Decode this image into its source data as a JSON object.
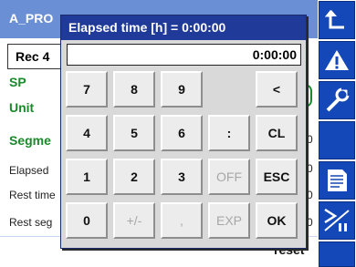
{
  "background": {
    "title": "A_PRO",
    "rec_label": "Rec 4",
    "labels": [
      "SP",
      "Unit",
      "Segme"
    ],
    "small_labels": [
      "Elapsed",
      "Rest time",
      "Rest seg"
    ],
    "field_digits": [
      "0",
      "0",
      "0",
      "0"
    ],
    "reset_label": "reset"
  },
  "sidebar": {
    "buttons": [
      "arrow-up-icon",
      "warning-icon",
      "wrench-icon",
      "blank",
      "document-icon",
      "start-pause-icon"
    ]
  },
  "dialog": {
    "title": "Elapsed time [h] = 0:00:00",
    "display_value": "0:00:00",
    "keys": [
      [
        "7",
        "8",
        "9",
        "",
        "<"
      ],
      [
        "4",
        "5",
        "6",
        ":",
        "CL"
      ],
      [
        "1",
        "2",
        "3",
        "OFF",
        "ESC"
      ],
      [
        "0",
        "+/-",
        ",",
        "EXP",
        "OK"
      ]
    ],
    "disabled_keys": [
      "+/-",
      ",",
      "OFF",
      "EXP"
    ]
  },
  "colors": {
    "title_bar": "#1f3a98",
    "sidebar_button": "#1447b8",
    "label_green": "#1a8a2a",
    "background_header": "#6b8fd4"
  }
}
